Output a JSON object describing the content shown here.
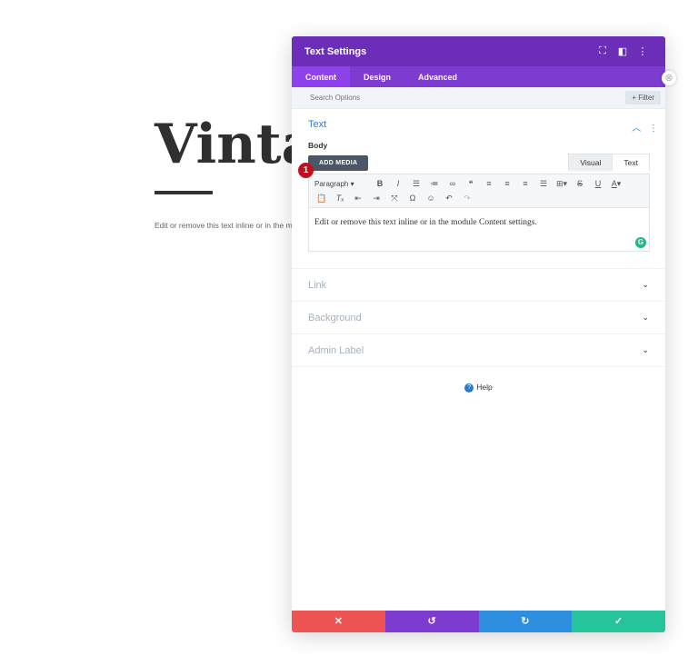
{
  "page": {
    "heading": "Vinta",
    "body_text": "Edit or remove this text inline or in the m"
  },
  "modal": {
    "title": "Text Settings",
    "header_icons": [
      "focus-icon",
      "split-view-icon",
      "more-vertical-icon"
    ],
    "tabs": [
      {
        "label": "Content",
        "active": true
      },
      {
        "label": "Design",
        "active": false
      },
      {
        "label": "Advanced",
        "active": false
      }
    ],
    "search": {
      "placeholder": "Search Options",
      "filter_label": "+ Filter"
    },
    "text_section": {
      "title": "Text",
      "body_label": "Body",
      "add_media_label": "ADD MEDIA",
      "visual_tab": "Visual",
      "text_tab": "Text",
      "format_select": "Paragraph",
      "content": "Edit or remove this text inline or in the module Content settings.",
      "step_badge": "1",
      "grammarly_icon": "G"
    },
    "collapsed_sections": [
      {
        "label": "Link"
      },
      {
        "label": "Background"
      },
      {
        "label": "Admin Label"
      }
    ],
    "help_label": "Help",
    "footer": {
      "cancel_color": "#ef5454",
      "undo_color": "#7e3bd0",
      "redo_color": "#2e8ee0",
      "save_color": "#26c49a"
    }
  }
}
